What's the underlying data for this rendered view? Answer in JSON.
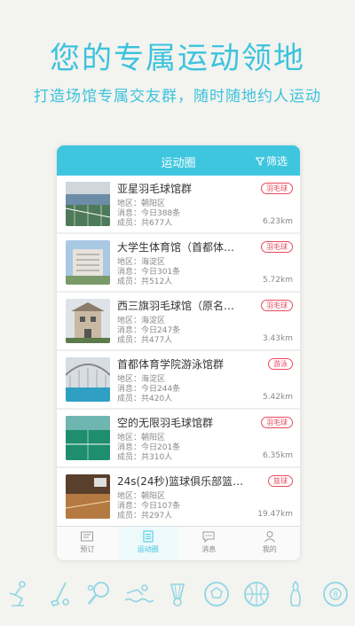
{
  "headline": "您的专属运动领地",
  "subline": "打造场馆专属交友群，随时随地约人运动",
  "app": {
    "title": "运动圈",
    "filter_label": "筛选"
  },
  "colors": {
    "accent": "#3ec6df",
    "tag": "#e84a5f"
  },
  "venues": [
    {
      "name": "亚星羽毛球馆群",
      "area": "地区：朝阳区",
      "messages": "消息：今日388条",
      "members": "成员：共677人",
      "tag": "羽毛球",
      "distance": "6.23km"
    },
    {
      "name": "大学生体育馆（首都体…",
      "area": "地区：海淀区",
      "messages": "消息：今日301条",
      "members": "成员：共512人",
      "tag": "羽毛球",
      "distance": "5.72km"
    },
    {
      "name": "西三旗羽毛球馆（原名…",
      "area": "地区：海淀区",
      "messages": "消息：今日247条",
      "members": "成员：共477人",
      "tag": "羽毛球",
      "distance": "3.43km"
    },
    {
      "name": "首都体育学院游泳馆群",
      "area": "地区：海淀区",
      "messages": "消息：今日244条",
      "members": "成员：共420人",
      "tag": "游泳",
      "distance": "5.42km"
    },
    {
      "name": "空的无限羽毛球馆群",
      "area": "地区：朝阳区",
      "messages": "消息：今日201条",
      "members": "成员：共310人",
      "tag": "羽毛球",
      "distance": "6.35km"
    },
    {
      "name": "24s(24秒)篮球俱乐部篮…",
      "area": "地区：朝阳区",
      "messages": "消息：今日107条",
      "members": "成员：共297人",
      "tag": "篮球",
      "distance": "19.47km"
    }
  ],
  "tabs": [
    {
      "label": "预订",
      "icon": "ticket-icon"
    },
    {
      "label": "运动圈",
      "icon": "list-icon"
    },
    {
      "label": "消息",
      "icon": "chat-icon"
    },
    {
      "label": "我的",
      "icon": "person-icon"
    }
  ],
  "sport_icons": [
    "skating-icon",
    "golf-icon",
    "table-tennis-icon",
    "swimming-icon",
    "badminton-icon",
    "soccer-icon",
    "basketball-icon",
    "bowling-icon",
    "billiards-icon"
  ]
}
